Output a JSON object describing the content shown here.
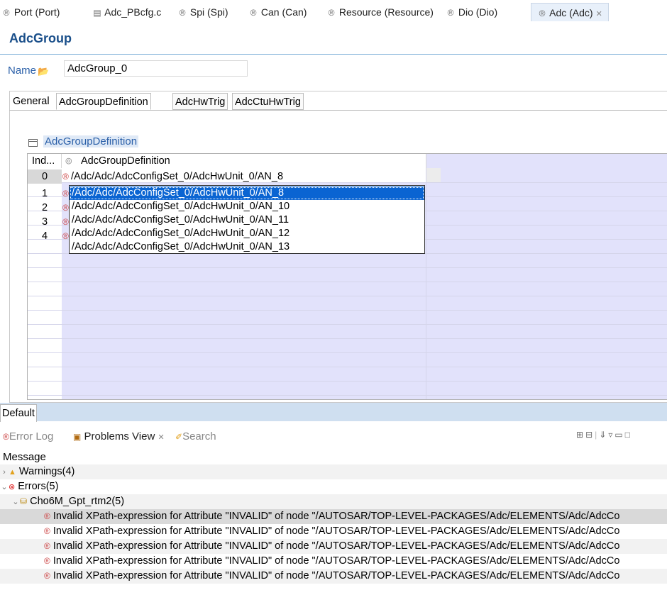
{
  "editor_tabs": [
    {
      "label": "Port (Port)",
      "icon": "module-icon"
    },
    {
      "label": "Adc_PBcfg.c",
      "icon": "file-icon"
    },
    {
      "label": "Spi (Spi)",
      "icon": "module-icon"
    },
    {
      "label": "Can (Can)",
      "icon": "module-icon"
    },
    {
      "label": "Resource (Resource)",
      "icon": "module-icon"
    },
    {
      "label": "Dio (Dio)",
      "icon": "module-icon"
    },
    {
      "label": "Adc (Adc)",
      "icon": "module-icon",
      "active": true
    }
  ],
  "form": {
    "title": "AdcGroup",
    "name_label": "Name",
    "name_value": "AdcGroup_0"
  },
  "section_tabs": [
    {
      "label": "General"
    },
    {
      "label": "AdcGroupDefinition",
      "active": true
    },
    {
      "label": "AdcHwTrig"
    },
    {
      "label": "AdcCtuHwTrig"
    }
  ],
  "table": {
    "section_title": "AdcGroupDefinition",
    "col_index_header": "Ind...",
    "col_value_header": "AdcGroupDefinition",
    "rows": [
      {
        "index": "0",
        "value": "/Adc/Adc/AdcConfigSet_0/AdcHwUnit_0/AN_8"
      },
      {
        "index": "1",
        "value": ""
      },
      {
        "index": "2",
        "value": ""
      },
      {
        "index": "3",
        "value": ""
      },
      {
        "index": "4",
        "value": ""
      }
    ]
  },
  "dropdown": {
    "options": [
      "/Adc/Adc/AdcConfigSet_0/AdcHwUnit_0/AN_8",
      "/Adc/Adc/AdcConfigSet_0/AdcHwUnit_0/AN_10",
      "/Adc/Adc/AdcConfigSet_0/AdcHwUnit_0/AN_11",
      "/Adc/Adc/AdcConfigSet_0/AdcHwUnit_0/AN_12",
      "/Adc/Adc/AdcConfigSet_0/AdcHwUnit_0/AN_13"
    ],
    "selected_index": 0
  },
  "bottom_tab": {
    "label": "Default"
  },
  "problems_view": {
    "tabs": [
      {
        "label": "Error Log"
      },
      {
        "label": "Problems View",
        "active": true
      },
      {
        "label": "Search"
      }
    ],
    "message_header": "Message",
    "warnings_label": "Warnings(4)",
    "errors_label": "Errors(5)",
    "project_label": "Cho6M_Gpt_rtm2(5)",
    "error_messages": [
      "Invalid XPath-expression for Attribute \"INVALID\" of node \"/AUTOSAR/TOP-LEVEL-PACKAGES/Adc/ELEMENTS/Adc/AdcCo",
      "Invalid XPath-expression for Attribute \"INVALID\" of node \"/AUTOSAR/TOP-LEVEL-PACKAGES/Adc/ELEMENTS/Adc/AdcCo",
      "Invalid XPath-expression for Attribute \"INVALID\" of node \"/AUTOSAR/TOP-LEVEL-PACKAGES/Adc/ELEMENTS/Adc/AdcCo",
      "Invalid XPath-expression for Attribute \"INVALID\" of node \"/AUTOSAR/TOP-LEVEL-PACKAGES/Adc/ELEMENTS/Adc/AdcCo",
      "Invalid XPath-expression for Attribute \"INVALID\" of node \"/AUTOSAR/TOP-LEVEL-PACKAGES/Adc/ELEMENTS/Adc/AdcCo"
    ]
  },
  "colors": {
    "accent": "#1a4f8a",
    "selection": "#0a64d2",
    "table_lavender": "#e2e2fb",
    "strip_blue": "#cfdff0"
  }
}
